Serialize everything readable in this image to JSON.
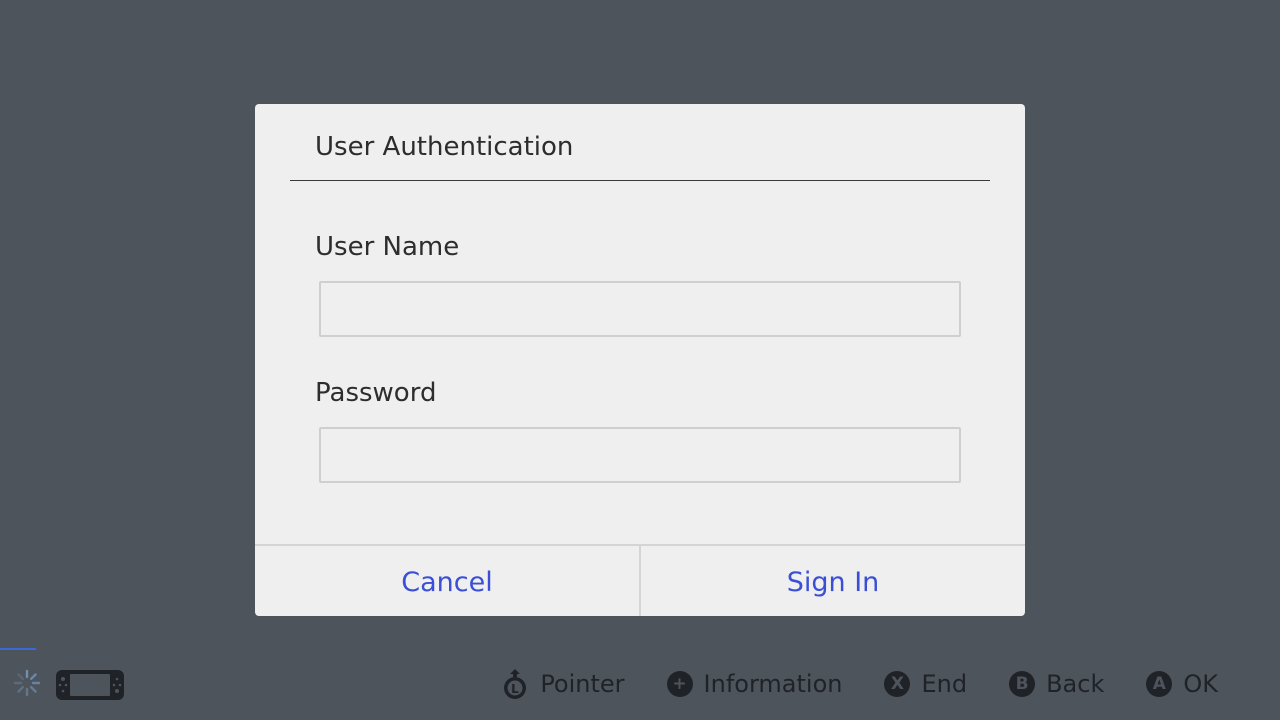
{
  "dialog": {
    "title": "User Authentication",
    "user_name_label": "User Name",
    "user_name_value": "",
    "password_label": "Password",
    "password_value": "",
    "cancel_label": "Cancel",
    "sign_in_label": "Sign In"
  },
  "footer": {
    "hints": [
      {
        "glyph": "L",
        "icon": "left-stick-icon",
        "label": "Pointer"
      },
      {
        "glyph": "+",
        "icon": "plus-button-icon",
        "label": "Information"
      },
      {
        "glyph": "X",
        "icon": "x-button-icon",
        "label": "End"
      },
      {
        "glyph": "B",
        "icon": "b-button-icon",
        "label": "Back"
      },
      {
        "glyph": "A",
        "icon": "a-button-icon",
        "label": "OK"
      }
    ]
  },
  "colors": {
    "background": "#4e545c",
    "dialog": "#efefef",
    "accent": "#3a4fd6",
    "footer_text": "#1f2328"
  }
}
